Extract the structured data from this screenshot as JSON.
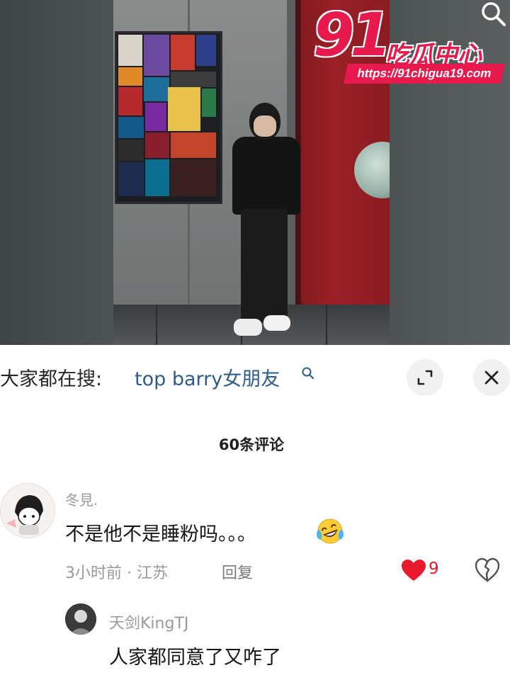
{
  "watermark": {
    "number": "91",
    "brand": "吃瓜中心",
    "url": "https://91chigua19.com"
  },
  "search": {
    "prefix": "大家都在搜:",
    "query": "top barry女朋友"
  },
  "comments_header": {
    "count_label": "60条评论"
  },
  "comments": [
    {
      "username": "冬見.",
      "text": "不是他不是睡粉吗。。。",
      "meta": "3小时前 · 江苏",
      "reply_label": "回复",
      "likes": "9",
      "liked": true,
      "emoji": "laughing-crying-emoji"
    },
    {
      "username": "天剑KingTJ",
      "text": "人家都同意了又咋了"
    }
  ],
  "colors": {
    "accent_red": "#e8194d",
    "like_red": "#e8192c",
    "query_blue": "#2c5d8c"
  }
}
